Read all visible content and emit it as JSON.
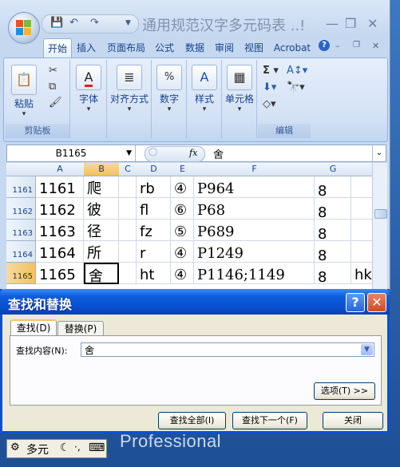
{
  "window": {
    "title": "通用规范汉字多元码表 ..!",
    "controls": {
      "minimize": "—",
      "restore": "❐",
      "close": "✕"
    }
  },
  "tabs": [
    "开始",
    "插入",
    "页面布局",
    "公式",
    "数据",
    "审阅",
    "视图",
    "Acrobat"
  ],
  "active_tab": "开始",
  "ribbon": {
    "clipboard": {
      "paste": "粘贴",
      "group": "剪贴板"
    },
    "font": {
      "label": "字体"
    },
    "alignment": {
      "label": "对齐方式"
    },
    "number": {
      "label": "数字"
    },
    "styles": {
      "label": "样式"
    },
    "cells": {
      "label": "单元格"
    },
    "editing": {
      "group": "编辑"
    }
  },
  "formula_bar": {
    "name_box": "B1165",
    "fx": "fx",
    "content": "舍"
  },
  "columns": [
    "A",
    "B",
    "C",
    "D",
    "E",
    "F",
    "G"
  ],
  "selected_column": "B",
  "rows": [
    {
      "num": "1161",
      "a": "1161",
      "b": "爬",
      "d": "rb",
      "e": "④",
      "f": "P964",
      "g": "8",
      "h": ""
    },
    {
      "num": "1162",
      "a": "1162",
      "b": "彼",
      "d": "fl",
      "e": "⑥",
      "f": "P68",
      "g": "8",
      "h": ""
    },
    {
      "num": "1163",
      "a": "1163",
      "b": "径",
      "d": "fz",
      "e": "⑤",
      "f": "P689",
      "g": "8",
      "h": ""
    },
    {
      "num": "1164",
      "a": "1164",
      "b": "所",
      "d": "r",
      "e": "④",
      "f": "P1249",
      "g": "8",
      "h": ""
    },
    {
      "num": "1165",
      "a": "1165",
      "b": "舍",
      "d": "ht",
      "e": "④",
      "f": "P1146;1149",
      "g": "8",
      "h": "hk"
    }
  ],
  "dialog": {
    "title": "查找和替换",
    "tab_find": "查找(D)",
    "tab_replace": "替换(P)",
    "find_label": "查找内容(N):",
    "find_value": "舍",
    "options_button": "选项(T) >>",
    "find_all_button": "查找全部(I)",
    "find_next_button": "查找下一个(F)",
    "close_button": "关闭"
  },
  "ime": {
    "mode": "多元"
  },
  "desktop_text": "Professional"
}
